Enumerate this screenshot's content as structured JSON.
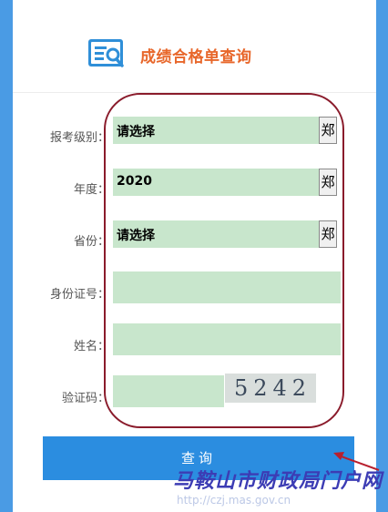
{
  "header": {
    "title": "成绩合格单查询",
    "icon": "search-document-icon",
    "icon_color": "#2f8fd8"
  },
  "form": {
    "level": {
      "label": "报考级别：",
      "value": "请选择",
      "dropdown_glyph": "郑"
    },
    "year": {
      "label": "年度：",
      "value": "2020",
      "dropdown_glyph": "郑"
    },
    "province": {
      "label": "省份：",
      "value": "请选择",
      "dropdown_glyph": "郑"
    },
    "id_number": {
      "label": "身份证号：",
      "value": ""
    },
    "name": {
      "label": "姓名：",
      "value": ""
    },
    "captcha": {
      "label": "验证码：",
      "value": "",
      "image_text": "5242"
    }
  },
  "query_button": {
    "label": "查询"
  },
  "watermark": {
    "text": "马鞍山市财政局门户网",
    "url": "http://czj.mas.gov.cn"
  },
  "colors": {
    "page_background": "#4a9be4",
    "accent_title": "#e8672b",
    "field_background": "#c8e6cc",
    "button": "#2b8de0",
    "annotation": "#8a1b2b"
  }
}
